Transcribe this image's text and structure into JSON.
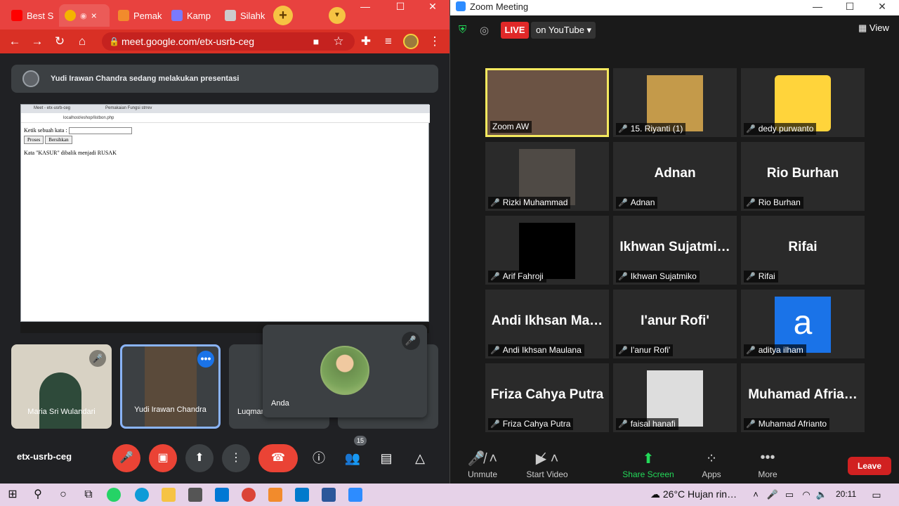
{
  "chrome": {
    "tabs": [
      {
        "label": "Best S",
        "color": "#ff0000"
      },
      {
        "label": "",
        "color": "#f4b400"
      },
      {
        "label": "Pemak",
        "color": "#f28b2c"
      },
      {
        "label": "Kamp",
        "color": "#7a7aff"
      },
      {
        "label": "Silahk",
        "color": "#cccccc"
      }
    ],
    "tab_close": "×",
    "new_tab": "+",
    "window_controls": {
      "minimize": "—",
      "maximize": "☐",
      "close": "✕"
    },
    "url": "meet.google.com/etx-usrb-ceg"
  },
  "meet": {
    "presenter_banner": "Yudi Irawan Chandra sedang melakukan presentasi",
    "shared": {
      "tab1": "Meet - etx-usrb-ceg",
      "tab2": "Pemakaian Fungsi strrev",
      "address": "localhost/eshop/listbon.php",
      "prompt": "Ketik sebuah kata :",
      "btn_process": "Proses",
      "btn_clear": "Bersihkan",
      "result": "Kata \"KASUR\" dibalik menjadi RUSAK"
    },
    "tiles": [
      {
        "name": "Maria Sri Wulandari"
      },
      {
        "name": "Yudi Irawan Chandra"
      },
      {
        "name": "Luqman"
      },
      {
        "name": ""
      }
    ],
    "self_name": "Anda",
    "meeting_code": "etx-usrb-ceg",
    "people_count": "15"
  },
  "zoom": {
    "title": "Zoom Meeting",
    "live": "LIVE",
    "live_target": "on YouTube ▾",
    "view_label": "View",
    "participants": [
      {
        "name": "Zoom AW",
        "display": "",
        "muted": false,
        "pic": "#6b5344"
      },
      {
        "name": "15. Riyanti (1)",
        "display": "",
        "muted": true,
        "pic": "#c49a4a"
      },
      {
        "name": "dedy purwanto",
        "display": "",
        "muted": true,
        "pic": "#ffd43b"
      },
      {
        "name": "Rizki Muhammad",
        "display": "",
        "muted": true,
        "pic": "#4f4a45"
      },
      {
        "name": "Adnan",
        "display": "Adnan",
        "muted": true
      },
      {
        "name": "Rio Burhan",
        "display": "Rio Burhan",
        "muted": true
      },
      {
        "name": "Arif Fahroji",
        "display": "",
        "muted": true,
        "pic": "#000000"
      },
      {
        "name": "Ikhwan Sujatmiko",
        "display": "Ikhwan  Sujatmi…",
        "muted": true
      },
      {
        "name": "Rifai",
        "display": "Rifai",
        "muted": true
      },
      {
        "name": "Andi Ikhsan Maulana",
        "display": "Andi  Ikhsan  Ma…",
        "muted": true
      },
      {
        "name": "I'anur Rofi'",
        "display": "I'anur Rofi'",
        "muted": true
      },
      {
        "name": "aditya ilham",
        "display": "",
        "muted": true,
        "pic": "#1a73e8",
        "letter": "a"
      },
      {
        "name": "Friza Cahya Putra",
        "display": "Friza Cahya Putra",
        "muted": true
      },
      {
        "name": "faisal hanafi",
        "display": "",
        "muted": true,
        "pic": "#dddddd"
      },
      {
        "name": "Muhamad Afrianto",
        "display": "Muhamad  Afria…",
        "muted": true
      }
    ],
    "buttons": {
      "unmute": "Unmute",
      "start_video": "Start Video",
      "share_screen": "Share Screen",
      "apps": "Apps",
      "more": "More",
      "leave": "Leave"
    }
  },
  "taskbar": {
    "weather": "26°C  Hujan rin…",
    "time": "20:11"
  }
}
